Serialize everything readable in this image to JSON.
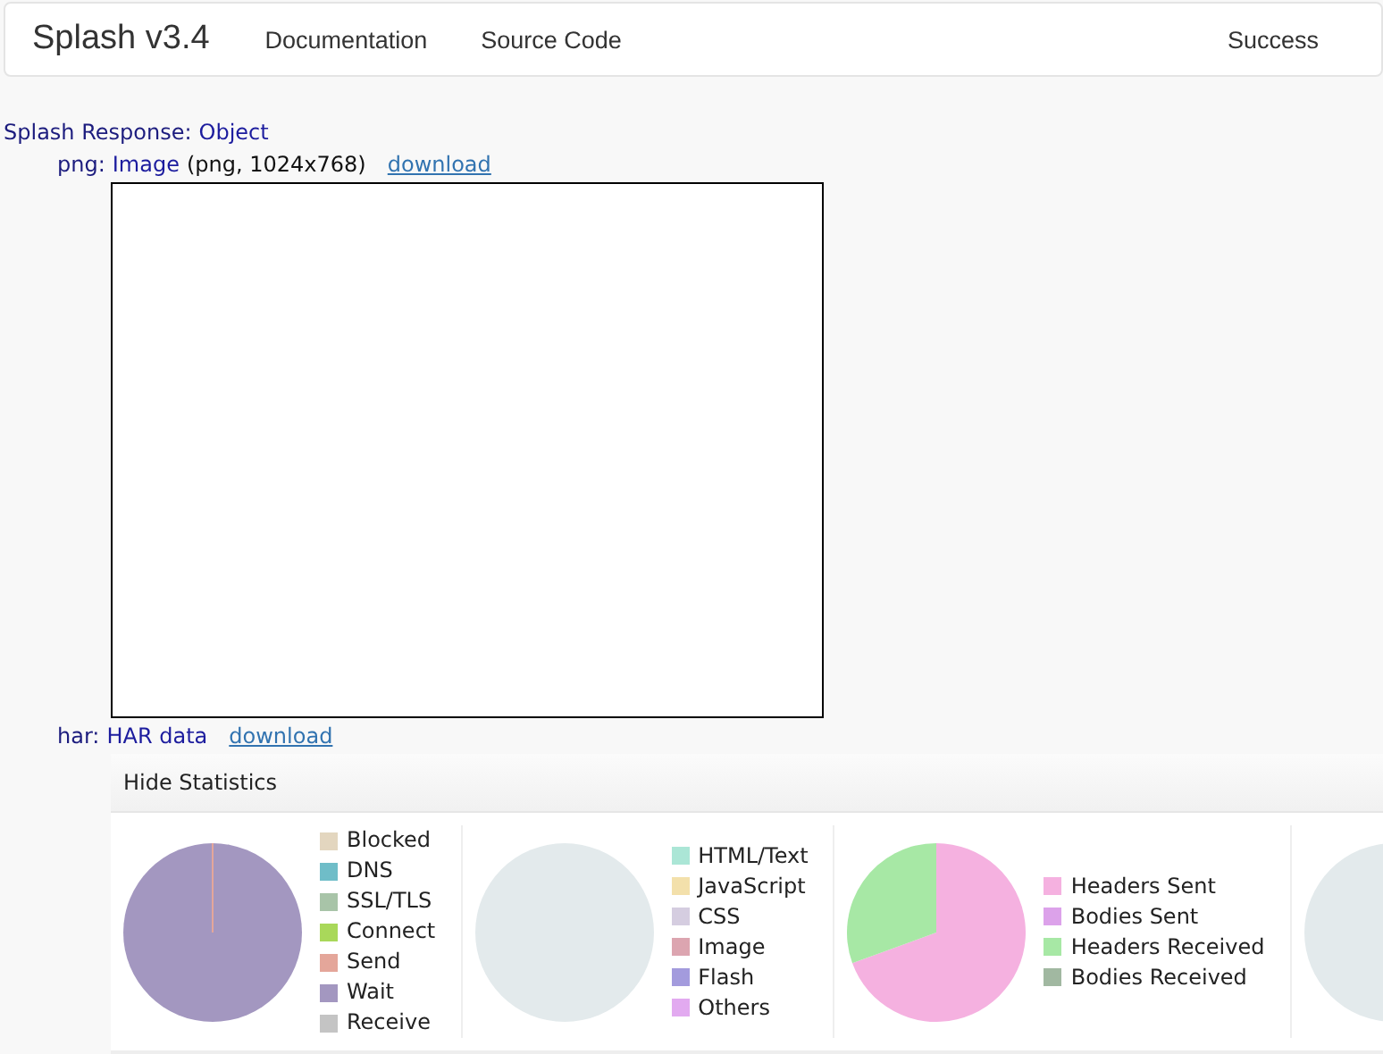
{
  "navbar": {
    "brand": "Splash v3.4",
    "links": [
      "Documentation",
      "Source Code"
    ],
    "status": "Success"
  },
  "response": {
    "label": "Splash Response:",
    "type": "Object"
  },
  "fields": [
    {
      "key": "png:",
      "type": "Image",
      "detail": "(png, 1024x768)",
      "link": "download",
      "kind": "image"
    },
    {
      "key": "har:",
      "type": "HAR data",
      "link": "download",
      "kind": "har"
    }
  ],
  "har_stats": {
    "toggle": "Hide Statistics",
    "groups": [
      {
        "kind": "timing",
        "legend": [
          {
            "label": "Blocked",
            "color": "#e3d6bf"
          },
          {
            "label": "DNS",
            "color": "#6fbdc8"
          },
          {
            "label": "SSL/TLS",
            "color": "#a8c4a8"
          },
          {
            "label": "Connect",
            "color": "#a9d85a"
          },
          {
            "label": "Send",
            "color": "#e4a69a"
          },
          {
            "label": "Wait",
            "color": "#a397c0"
          },
          {
            "label": "Receive",
            "color": "#c4c4c4"
          }
        ]
      },
      {
        "kind": "empty",
        "legend": [
          {
            "label": "HTML/Text",
            "color": "#abe6d6"
          },
          {
            "label": "JavaScript",
            "color": "#f3e0ab"
          },
          {
            "label": "CSS",
            "color": "#d5cde0"
          },
          {
            "label": "Image",
            "color": "#dca5b0"
          },
          {
            "label": "Flash",
            "color": "#a39bdd"
          },
          {
            "label": "Others",
            "color": "#e2aaf0"
          }
        ]
      },
      {
        "kind": "split",
        "legend": [
          {
            "label": "Headers Sent",
            "color": "#f5b1e0"
          },
          {
            "label": "Bodies Sent",
            "color": "#dca2ea"
          },
          {
            "label": "Headers Received",
            "color": "#a7e8a5"
          },
          {
            "label": "Bodies Received",
            "color": "#a1b8a1"
          }
        ]
      },
      {
        "kind": "empty"
      }
    ]
  }
}
